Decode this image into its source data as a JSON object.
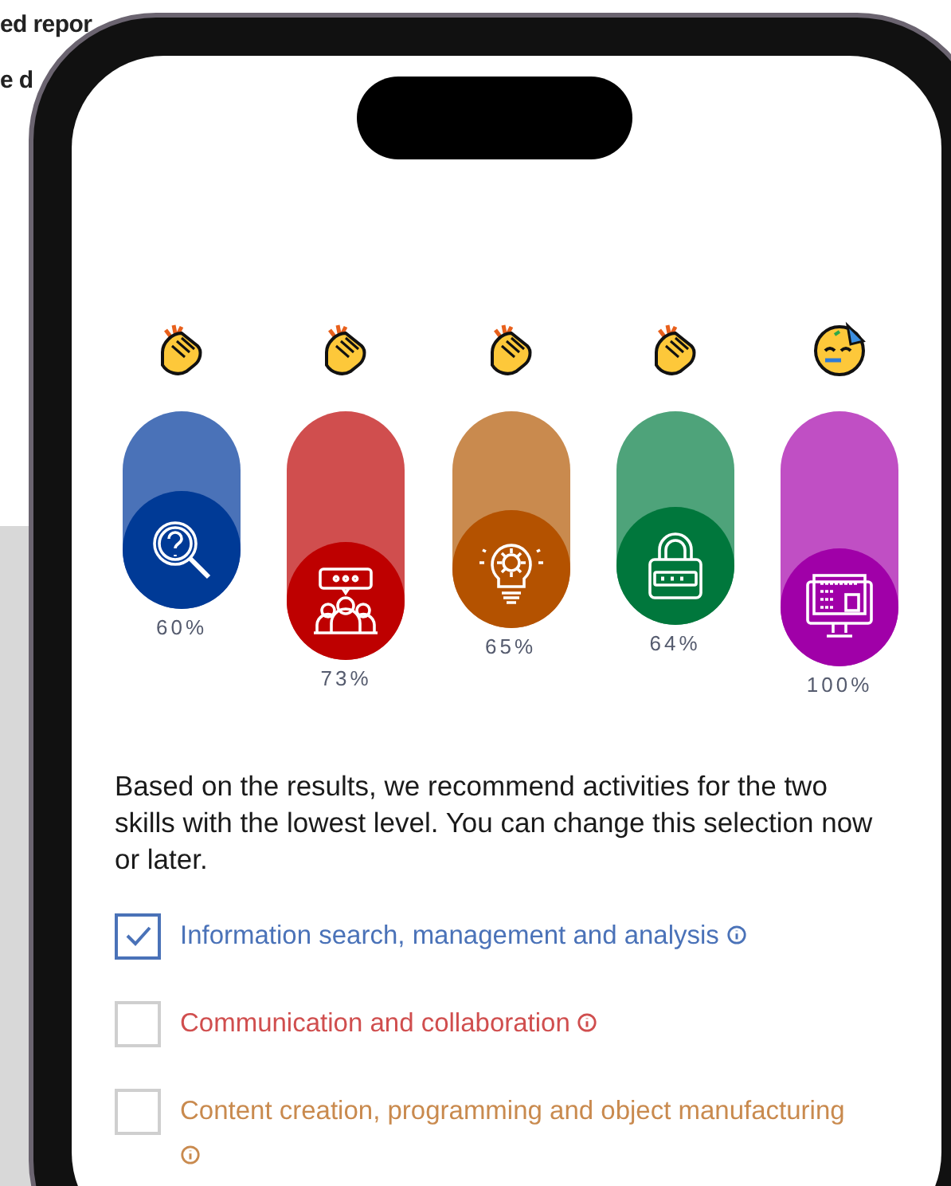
{
  "background_page": {
    "lines": [
      "ed repor",
      "e d"
    ]
  },
  "skills": [
    {
      "kind": "clap",
      "color": "#4a72b8",
      "percent": "60%"
    },
    {
      "kind": "clap",
      "color": "#d04e4e",
      "percent": "73%"
    },
    {
      "kind": "clap",
      "color": "#c98a4e",
      "percent": "65%"
    },
    {
      "kind": "clap",
      "color": "#4ea37a",
      "percent": "64%"
    },
    {
      "kind": "party",
      "color": "#c04fc4",
      "percent": "100%"
    }
  ],
  "recommendation": "Based on the results, we recommend activities for the two skills with the lowest level. You can change this selection now or later.",
  "options": [
    {
      "label": "Information search, management and analysis",
      "checked": true,
      "color": "#4a72b8"
    },
    {
      "label": "Communication and collaboration",
      "checked": false,
      "color": "#d04e4e"
    },
    {
      "label": "Content creation, programming and object manufacturing",
      "checked": false,
      "color": "#c98a4e"
    }
  ]
}
